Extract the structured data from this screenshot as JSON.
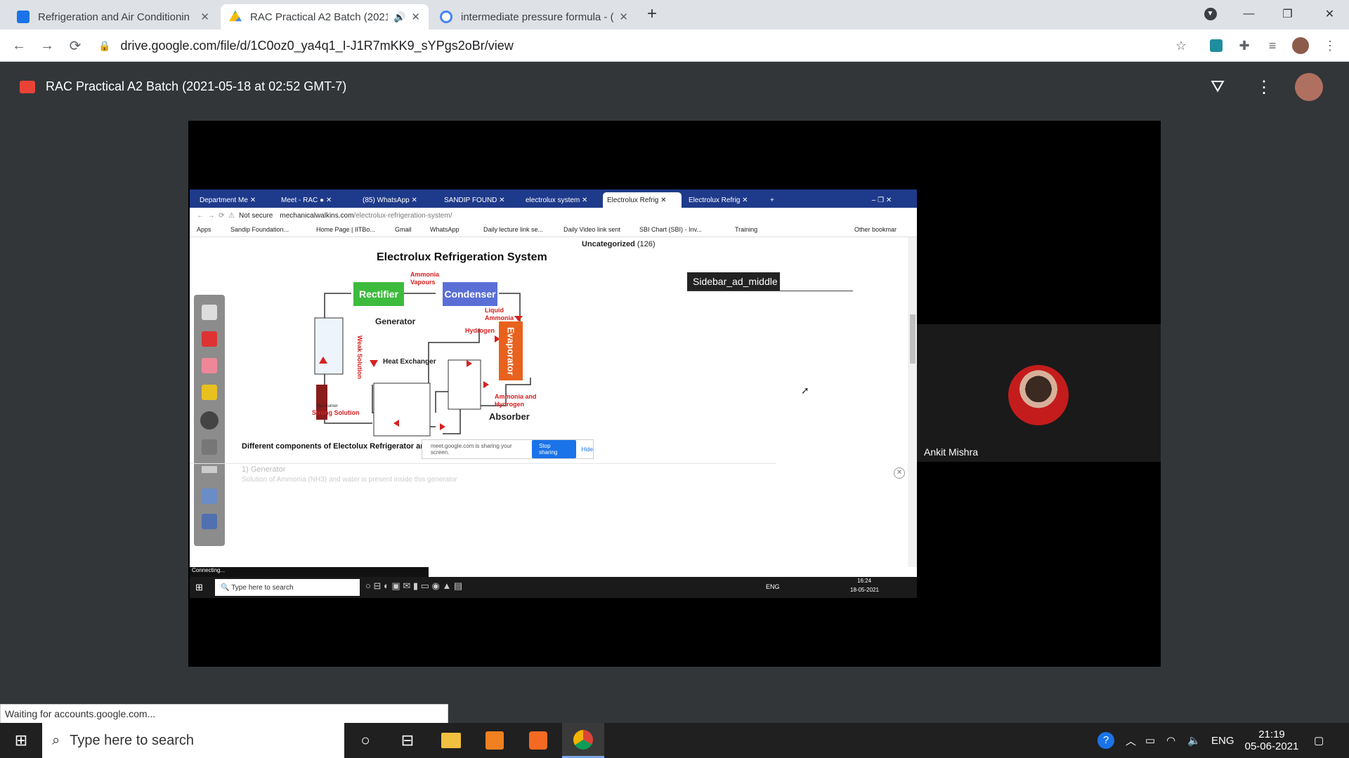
{
  "browser": {
    "tabs": [
      {
        "title": "Refrigeration and Air Conditionin",
        "active": false
      },
      {
        "title": "RAC Practical A2 Batch (2021",
        "active": true
      },
      {
        "title": "intermediate pressure formula - (",
        "active": false
      }
    ],
    "url": "drive.google.com/file/d/1C0oz0_ya4q1_I-J1R7mKK9_sYPgs2oBr/view",
    "status": "Waiting for accounts.google.com..."
  },
  "drive": {
    "title": "RAC Practical A2 Batch (2021-05-18 at 02:52 GMT-7)"
  },
  "shared_screen": {
    "tabs": [
      "Department Me",
      "Meet - RAC",
      "(85) WhatsApp",
      "SANDIP FOUND",
      "electrolux system",
      "Electrolux Refrig",
      "Electrolux Refrig"
    ],
    "not_secure": "Not secure",
    "url_host": "mechanicalwalkins.com",
    "url_path": "/electrolux-refrigeration-system/",
    "bookmarks": [
      "Apps",
      "Sandip Foundation...",
      "Home Page | IITBo...",
      "Gmail",
      "WhatsApp",
      "Daily lecture link se...",
      "Daily Video link sent",
      "SBI Chart (SBI) - Inv...",
      "Training",
      "Other bookmar"
    ],
    "page": {
      "diagram_title": "Electrolux Refrigeration System",
      "rectifier": "Rectifier",
      "condenser": "Condenser",
      "evaporator": "Evaporator",
      "ammonia_vapours_1": "Ammonia",
      "ammonia_vapours_2": "Vapours",
      "generator": "Generator",
      "weak_solution": "Weak Solution",
      "heat_exchanger": "Heat Exchanger",
      "liquid_ammonia_1": "Liquid",
      "liquid_ammonia_2": "Ammonia",
      "hydrogen": "Hydrogen",
      "ammonia_hydrogen_1": "Ammonia and",
      "ammonia_hydrogen_2": "Hydrogen",
      "absorber": "Absorber",
      "gas_burner": "Gas Burner",
      "strong_solution": "Strong Solution",
      "components_heading": "Different components of Electolux Refrigerator are :-",
      "item_1": "1) Generator",
      "item_1_desc": "Solution of Ammonia (NH3) and water is present inside this generator",
      "sidebar_category": "Uncategorized",
      "sidebar_count": "(126)",
      "sidebar_ad": "Sidebar_ad_middle",
      "sharing_notice": "meet.google.com is sharing your screen.",
      "stop_sharing": "Stop sharing",
      "hide": "Hide",
      "connecting": "Connecting..."
    },
    "taskbar": {
      "search": "Type here to search",
      "lang": "ENG",
      "time": "16:24",
      "date": "18-05-2021"
    }
  },
  "participant": {
    "name": "Ankit Mishra"
  },
  "taskbar": {
    "search": "Type here to search",
    "lang": "ENG",
    "time": "21:19",
    "date": "05-06-2021"
  },
  "colors": {
    "rectifier": "#3dbb3d",
    "condenser": "#5a6fd6",
    "evaporator": "#e8621e",
    "accent": "#1a73e8"
  }
}
